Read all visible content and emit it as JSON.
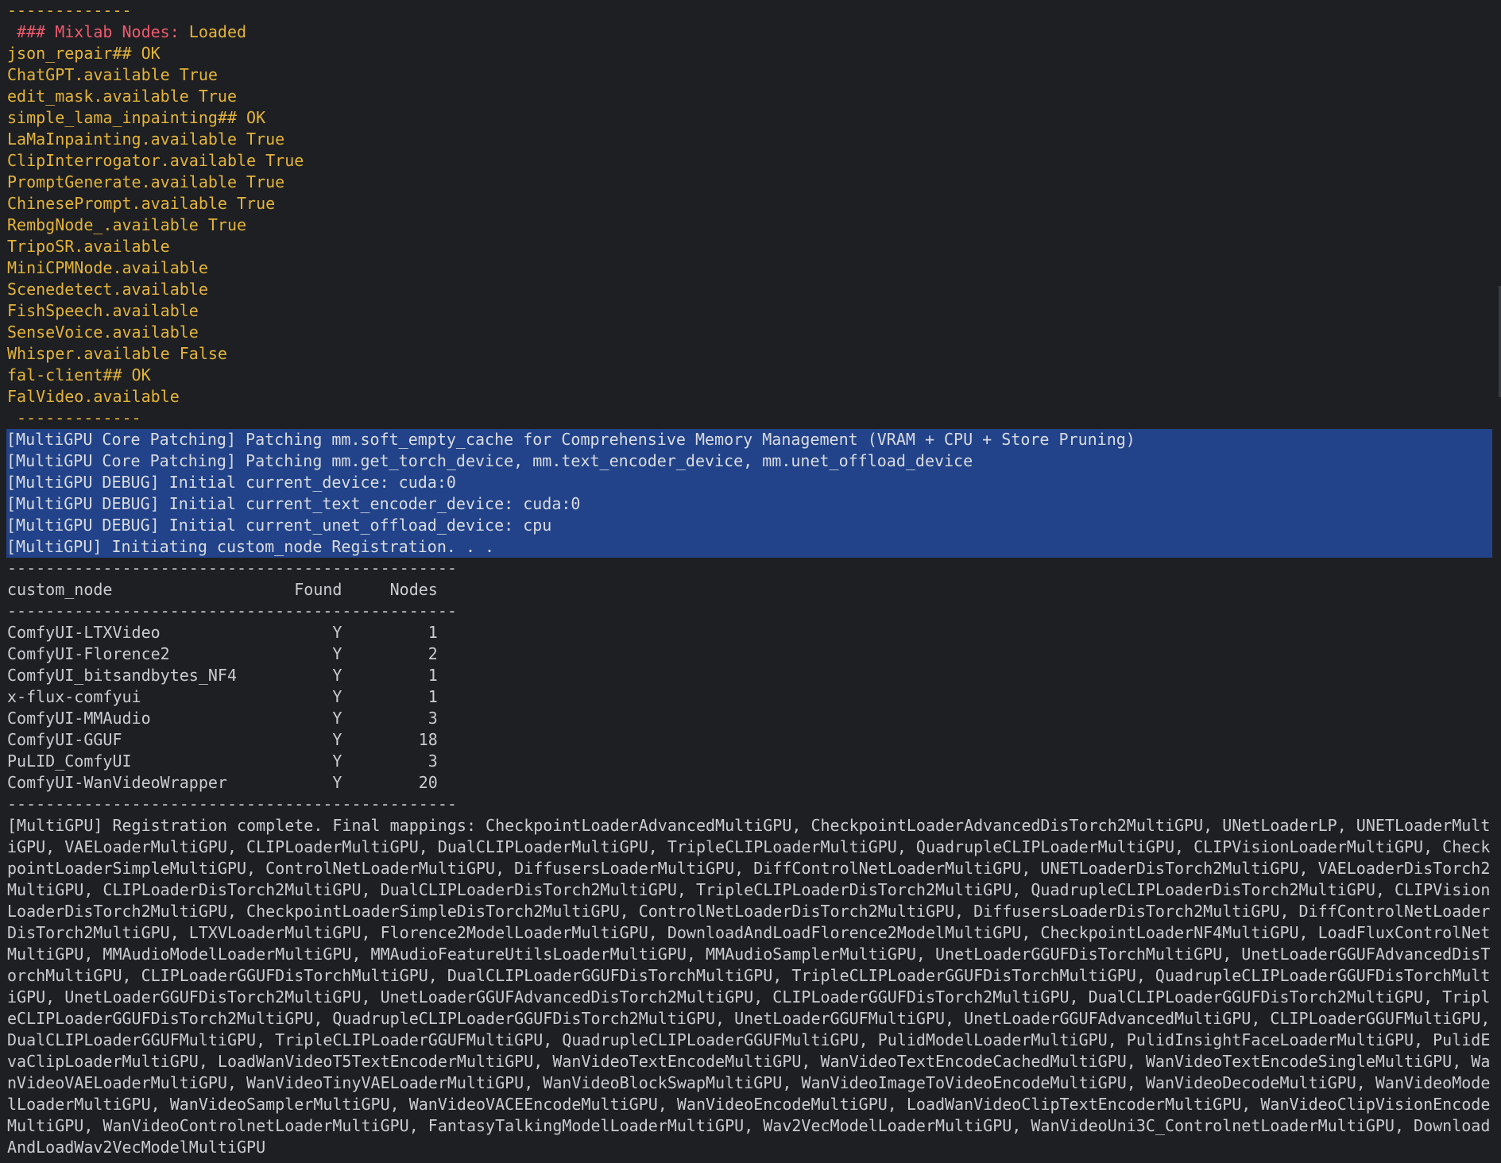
{
  "colors": {
    "background": "#1e1f22",
    "text": "#c9ccd1",
    "yellow": "#e3b43b",
    "red": "#ee5a6e",
    "selection": "#22438a"
  },
  "top_separator": "-------------",
  "mixlab": {
    "header_prefix": " ### Mixlab Nodes: ",
    "header_status": "Loaded",
    "lines": [
      "json_repair## OK",
      "ChatGPT.available True",
      "edit_mask.available True",
      "simple_lama_inpainting## OK",
      "LaMaInpainting.available True",
      "ClipInterrogator.available True",
      "PromptGenerate.available True",
      "ChinesePrompt.available True",
      "RembgNode_.available True",
      "TripoSR.available",
      "MiniCPMNode.available",
      "Scenedetect.available",
      "FishSpeech.available",
      "SenseVoice.available",
      "Whisper.available False",
      "fal-client## OK",
      "FalVideo.available"
    ],
    "footer_separator": " -------------"
  },
  "selected_lines": [
    "[MultiGPU Core Patching] Patching mm.soft_empty_cache for Comprehensive Memory Management (VRAM + CPU + Store Pruning)",
    "[MultiGPU Core Patching] Patching mm.get_torch_device, mm.text_encoder_device, mm.unet_offload_device",
    "[MultiGPU DEBUG] Initial current_device: cuda:0",
    "[MultiGPU DEBUG] Initial current_text_encoder_device: cuda:0",
    "[MultiGPU DEBUG] Initial current_unet_offload_device: cpu",
    "[MultiGPU] Initiating custom_node Registration. . ."
  ],
  "table": {
    "separator": "-----------------------------------------------",
    "header": "custom_node                   Found     Nodes",
    "rows": [
      "ComfyUI-LTXVideo                  Y         1",
      "ComfyUI-Florence2                 Y         2",
      "ComfyUI_bitsandbytes_NF4          Y         1",
      "x-flux-comfyui                    Y         1",
      "ComfyUI-MMAudio                   Y         3",
      "ComfyUI-GGUF                      Y        18",
      "PuLID_ComfyUI                     Y         3",
      "ComfyUI-WanVideoWrapper           Y        20"
    ]
  },
  "final_mappings": "[MultiGPU] Registration complete. Final mappings: CheckpointLoaderAdvancedMultiGPU, CheckpointLoaderAdvancedDisTorch2MultiGPU, UNetLoaderLP, UNETLoaderMultiGPU, VAELoaderMultiGPU, CLIPLoaderMultiGPU, DualCLIPLoaderMultiGPU, TripleCLIPLoaderMultiGPU, QuadrupleCLIPLoaderMultiGPU, CLIPVisionLoaderMultiGPU, CheckpointLoaderSimpleMultiGPU, ControlNetLoaderMultiGPU, DiffusersLoaderMultiGPU, DiffControlNetLoaderMultiGPU, UNETLoaderDisTorch2MultiGPU, VAELoaderDisTorch2MultiGPU, CLIPLoaderDisTorch2MultiGPU, DualCLIPLoaderDisTorch2MultiGPU, TripleCLIPLoaderDisTorch2MultiGPU, QuadrupleCLIPLoaderDisTorch2MultiGPU, CLIPVisionLoaderDisTorch2MultiGPU, CheckpointLoaderSimpleDisTorch2MultiGPU, ControlNetLoaderDisTorch2MultiGPU, DiffusersLoaderDisTorch2MultiGPU, DiffControlNetLoaderDisTorch2MultiGPU, LTXVLoaderMultiGPU, Florence2ModelLoaderMultiGPU, DownloadAndLoadFlorence2ModelMultiGPU, CheckpointLoaderNF4MultiGPU, LoadFluxControlNetMultiGPU, MMAudioModelLoaderMultiGPU, MMAudioFeatureUtilsLoaderMultiGPU, MMAudioSamplerMultiGPU, UnetLoaderGGUFDisTorchMultiGPU, UnetLoaderGGUFAdvancedDisTorchMultiGPU, CLIPLoaderGGUFDisTorchMultiGPU, DualCLIPLoaderGGUFDisTorchMultiGPU, TripleCLIPLoaderGGUFDisTorchMultiGPU, QuadrupleCLIPLoaderGGUFDisTorchMultiGPU, UnetLoaderGGUFDisTorch2MultiGPU, UnetLoaderGGUFAdvancedDisTorch2MultiGPU, CLIPLoaderGGUFDisTorch2MultiGPU, DualCLIPLoaderGGUFDisTorch2MultiGPU, TripleCLIPLoaderGGUFDisTorch2MultiGPU, QuadrupleCLIPLoaderGGUFDisTorch2MultiGPU, UnetLoaderGGUFMultiGPU, UnetLoaderGGUFAdvancedMultiGPU, CLIPLoaderGGUFMultiGPU, DualCLIPLoaderGGUFMultiGPU, TripleCLIPLoaderGGUFMultiGPU, QuadrupleCLIPLoaderGGUFMultiGPU, PulidModelLoaderMultiGPU, PulidInsightFaceLoaderMultiGPU, PulidEvaClipLoaderMultiGPU, LoadWanVideoT5TextEncoderMultiGPU, WanVideoTextEncodeMultiGPU, WanVideoTextEncodeCachedMultiGPU, WanVideoTextEncodeSingleMultiGPU, WanVideoVAELoaderMultiGPU, WanVideoTinyVAELoaderMultiGPU, WanVideoBlockSwapMultiGPU, WanVideoImageToVideoEncodeMultiGPU, WanVideoDecodeMultiGPU, WanVideoModelLoaderMultiGPU, WanVideoSamplerMultiGPU, WanVideoVACEEncodeMultiGPU, WanVideoEncodeMultiGPU, LoadWanVideoClipTextEncoderMultiGPU, WanVideoClipVisionEncodeMultiGPU, WanVideoControlnetLoaderMultiGPU, FantasyTalkingModelLoaderMultiGPU, Wav2VecModelLoaderMultiGPU, WanVideoUni3C_ControlnetLoaderMultiGPU, DownloadAndLoadWav2VecModelMultiGPU",
  "bottom_partial": ". . ."
}
